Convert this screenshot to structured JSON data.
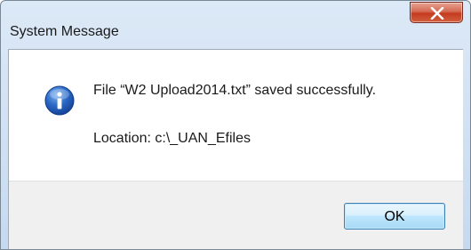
{
  "window": {
    "title": "System Message",
    "close_icon": "close-icon"
  },
  "message": {
    "icon": "info-icon",
    "line1": "File “W2 Upload2014.txt” saved successfully.",
    "line2": "Location: c:\\_UAN_Efiles"
  },
  "buttons": {
    "ok_label": "OK"
  },
  "colors": {
    "titlebar": "#cfe0f3",
    "close_button": "#c43a1f",
    "info_icon": "#1e5cb3",
    "footer": "#f0f0f0",
    "ok_button": "#bee6fd"
  }
}
